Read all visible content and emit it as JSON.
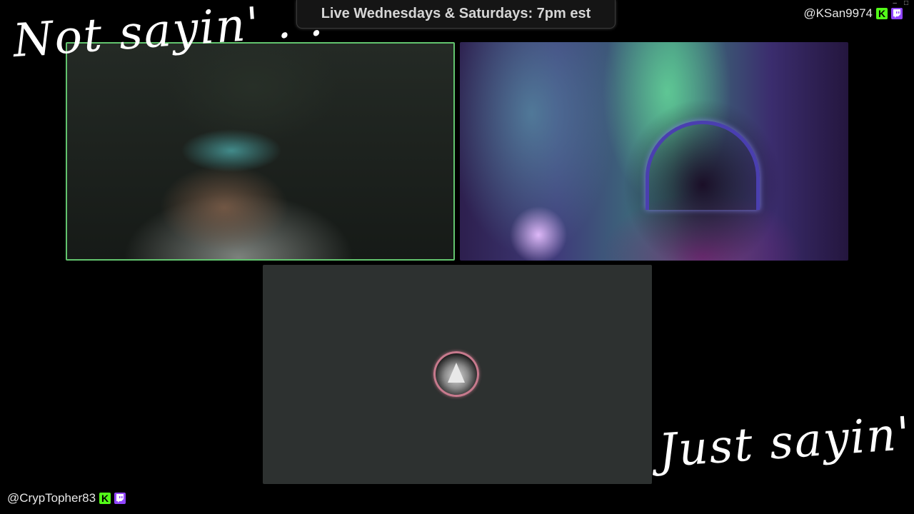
{
  "banner": {
    "text": "Live Wednesdays & Saturdays: 7pm est"
  },
  "handles": {
    "top_right": "@KSan9974",
    "bottom_left": "@CrypTopher83",
    "kick_glyph": "K"
  },
  "overlay_text": {
    "top_left": "Not sayin' . .",
    "bottom_right": "Just sayin' . ."
  },
  "window_controls": {
    "minimize": "–",
    "maximize": "□"
  },
  "participants": [
    {
      "video_state": "camera-on",
      "active_speaker": true,
      "border_color": "#62c46e"
    },
    {
      "video_state": "camera-on",
      "active_speaker": false
    },
    {
      "video_state": "camera-off",
      "avatar": "mountain-logo-icon"
    }
  ],
  "colors": {
    "background": "#000000",
    "active_border": "#62c46e",
    "kick_green": "#53fc18",
    "twitch_purple": "#9146ff",
    "empty_tile": "#2d3130"
  }
}
